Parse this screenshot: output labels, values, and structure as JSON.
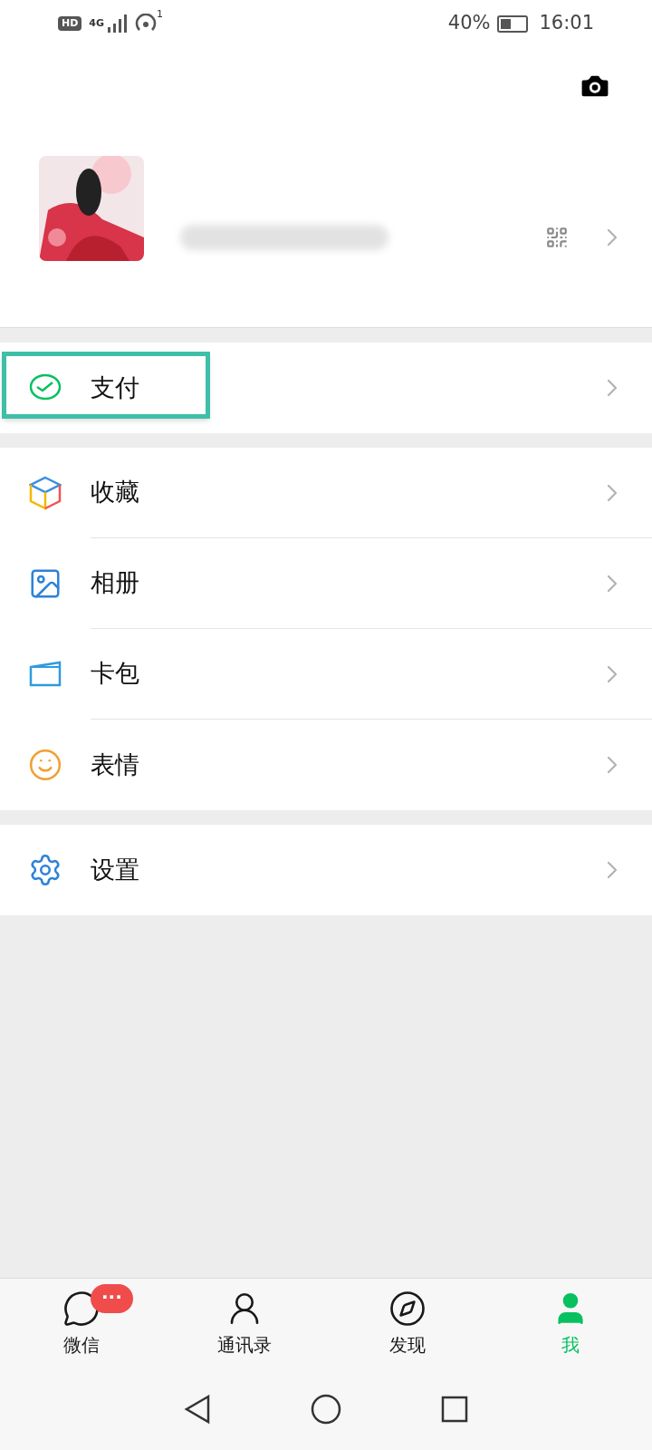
{
  "status_bar": {
    "hd": "HD",
    "network": "4G",
    "hotspot_count": "1",
    "battery": "40%",
    "time": "16:01"
  },
  "menu_sections": [
    [
      {
        "kind": "pay",
        "label": "支付",
        "highlighted": true
      }
    ],
    [
      {
        "kind": "favorites",
        "label": "收藏",
        "highlighted": false
      },
      {
        "kind": "album",
        "label": "相册",
        "highlighted": false
      },
      {
        "kind": "cards",
        "label": "卡包",
        "highlighted": false
      },
      {
        "kind": "stickers",
        "label": "表情",
        "highlighted": false
      }
    ],
    [
      {
        "kind": "settings",
        "label": "设置",
        "highlighted": false
      }
    ]
  ],
  "tabs": [
    {
      "kind": "chats",
      "label": "微信",
      "selected": false,
      "badge": "···"
    },
    {
      "kind": "contacts",
      "label": "通讯录",
      "selected": false
    },
    {
      "kind": "discover",
      "label": "发现",
      "selected": false
    },
    {
      "kind": "me",
      "label": "我",
      "selected": true
    }
  ]
}
